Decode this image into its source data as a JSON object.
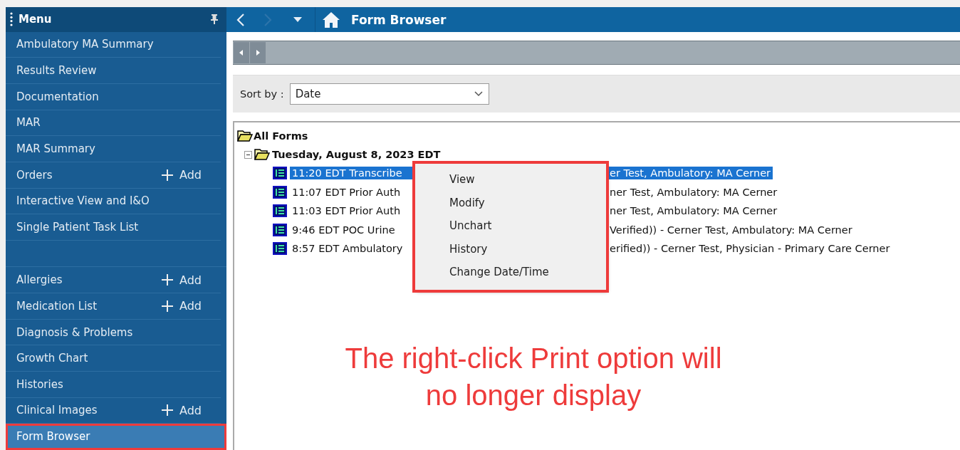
{
  "sidebar": {
    "title": "Menu",
    "pinned": true,
    "groups": [
      [
        {
          "label": "Ambulatory MA Summary",
          "selected": false,
          "highlighted": false
        },
        {
          "label": "Results Review",
          "selected": false,
          "highlighted": false
        },
        {
          "label": "Documentation",
          "selected": false,
          "highlighted": false
        },
        {
          "label": "MAR",
          "selected": false,
          "highlighted": false
        },
        {
          "label": "MAR Summary",
          "selected": false,
          "highlighted": false
        },
        {
          "label": "Orders",
          "add": "Add",
          "selected": false,
          "highlighted": false
        },
        {
          "label": "Interactive View and I&O",
          "selected": false,
          "highlighted": false
        },
        {
          "label": "Single Patient Task List",
          "selected": false,
          "highlighted": false
        }
      ],
      [
        {
          "label": "Allergies",
          "add": "Add",
          "selected": false,
          "highlighted": false
        },
        {
          "label": "Medication List",
          "add": "Add",
          "selected": false,
          "highlighted": false
        },
        {
          "label": "Diagnosis & Problems",
          "selected": false,
          "highlighted": false
        },
        {
          "label": "Growth Chart",
          "selected": false,
          "highlighted": false
        },
        {
          "label": "Histories",
          "selected": false,
          "highlighted": false
        },
        {
          "label": "Clinical Images",
          "add": "Add",
          "selected": false,
          "highlighted": false
        },
        {
          "label": "Form Browser",
          "selected": true,
          "highlighted": true
        }
      ]
    ]
  },
  "header": {
    "title": "Form Browser",
    "back_disabled": false,
    "forward_disabled": true
  },
  "sort": {
    "label": "Sort by :",
    "value": "Date"
  },
  "tree": {
    "label": "All Forms",
    "children": [
      {
        "label": "Tuesday, August 8, 2023 EDT",
        "expanded": true,
        "children": [
          {
            "start": "11:20 EDT Transcribe",
            "end": "er Test, Ambulatory: MA Cerner",
            "selected": true
          },
          {
            "start": "11:07 EDT Prior Auth",
            "end": "ner Test, Ambulatory: MA Cerner",
            "selected": false
          },
          {
            "start": "11:03 EDT Prior Auth",
            "end": "ner Test, Ambulatory: MA Cerner",
            "selected": false
          },
          {
            "start": "9:46 EDT POC Urine",
            "end": "Verified)) - Cerner Test, Ambulatory: MA Cerner",
            "selected": false
          },
          {
            "start": "8:57 EDT Ambulatory",
            "end": "erified)) - Cerner Test, Physician - Primary Care Cerner",
            "selected": false
          }
        ]
      }
    ]
  },
  "context_menu": {
    "highlighted": true,
    "items": [
      "View",
      "Modify",
      "Unchart",
      "History",
      "Change Date/Time"
    ]
  },
  "annotation": "The right-click Print option will no longer display"
}
